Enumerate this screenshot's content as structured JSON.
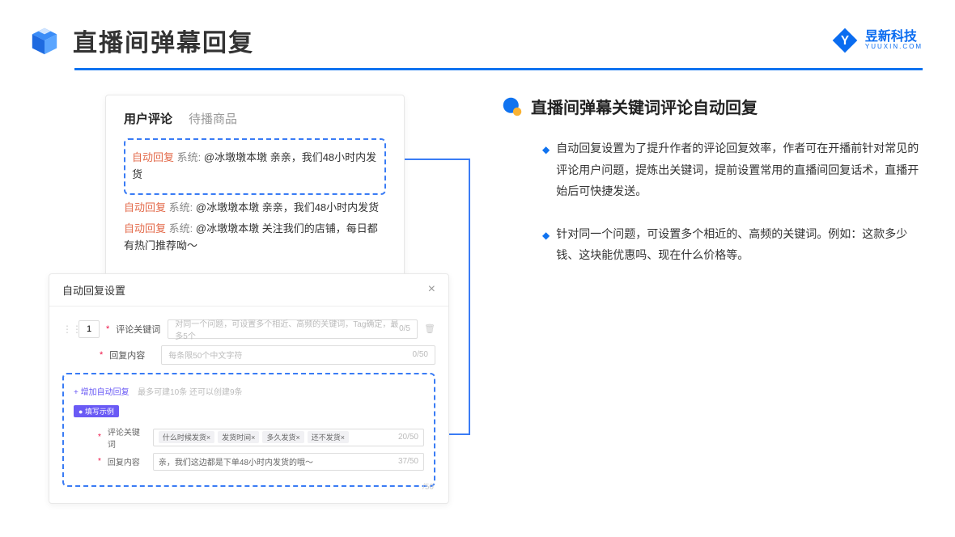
{
  "header": {
    "title": "直播间弹幕回复",
    "brand_cn": "昱新科技",
    "brand_en": "YUUXIN.COM"
  },
  "commentCard": {
    "tabs": {
      "active": "用户评论",
      "inactive": "待播商品"
    },
    "highlighted": {
      "label": "自动回复",
      "sys": "系统:",
      "body": "@冰墩墩本墩 亲亲，我们48小时内发货"
    },
    "line2": {
      "label": "自动回复",
      "sys": "系统:",
      "body": "@冰墩墩本墩 亲亲，我们48小时内发货"
    },
    "line3": {
      "label": "自动回复",
      "sys": "系统:",
      "body": "@冰墩墩本墩 关注我们的店铺，每日都有热门推荐呦～"
    }
  },
  "settings": {
    "title": "自动回复设置",
    "index": "1",
    "kw_label": "评论关键词",
    "kw_placeholder": "对同一个问题，可设置多个相近、高频的关键词，Tag确定，最多5个",
    "kw_counter": "0/5",
    "content_label": "回复内容",
    "content_placeholder": "每条限50个中文字符",
    "content_counter": "0/50",
    "add_link": "+ 增加自动回复",
    "add_hint": "最多可建10条 还可以创建9条",
    "example_badge": "● 填写示例",
    "ex_kw_label": "评论关键词",
    "ex_tags": [
      "什么时候发货×",
      "发货时间×",
      "多久发货×",
      "还不发货×"
    ],
    "ex_kw_counter": "20/50",
    "ex_content_label": "回复内容",
    "ex_content_value": "亲，我们这边都是下单48小时内发货的哦～",
    "ex_content_counter": "37/50",
    "outer_counter": "/50"
  },
  "right": {
    "sub_title": "直播间弹幕关键词评论自动回复",
    "bullet1": "自动回复设置为了提升作者的评论回复效率，作者可在开播前针对常见的评论用户问题，提炼出关键词，提前设置常用的直播间回复话术，直播开始后可快捷发送。",
    "bullet2": "针对同一个问题，可设置多个相近的、高频的关键词。例如：这款多少钱、这块能优惠吗、现在什么价格等。"
  }
}
